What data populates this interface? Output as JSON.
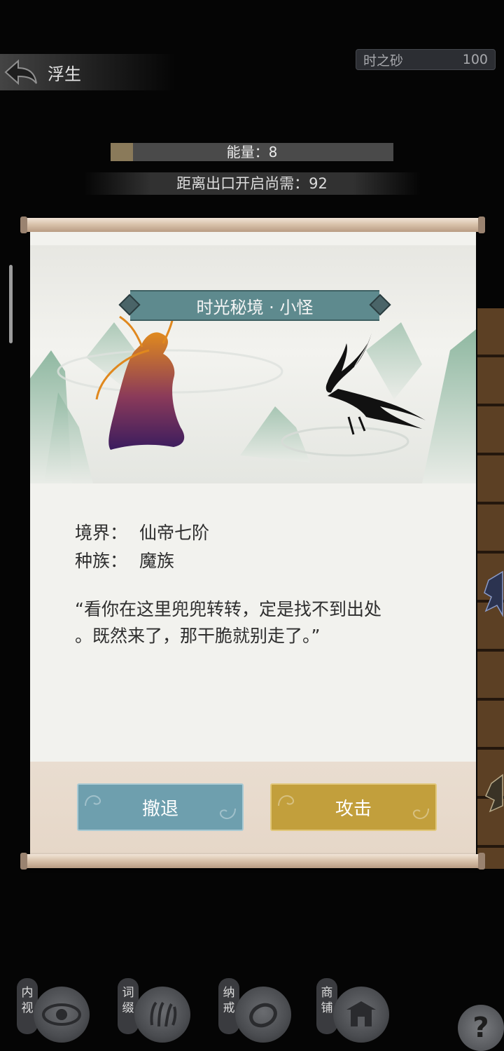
{
  "header": {
    "back_title": "浮生",
    "currency_label": "时之砂",
    "currency_value": "100"
  },
  "status": {
    "energy_text": "能量：8",
    "energy_progress": 0.08,
    "exit_text": "距离出口开启尚需：92"
  },
  "dialog": {
    "title": "时光秘境 · 小怪",
    "realm_label": "境界：",
    "realm_value": "仙帝七阶",
    "race_label": "种族：",
    "race_value": "魔族",
    "quote_line1": "“看你在这里兜兜转转，定是找不到出处",
    "quote_line2": "。既然来了，那干脆就别走了。”",
    "retreat_label": "撤退",
    "attack_label": "攻击"
  },
  "nav": [
    {
      "tag": "内视",
      "icon": "eye-icon"
    },
    {
      "tag": "词缀",
      "icon": "claw-icon"
    },
    {
      "tag": "纳戒",
      "icon": "ring-icon"
    },
    {
      "tag": "商铺",
      "icon": "shop-icon"
    }
  ],
  "help_label": "?",
  "colors": {
    "retreat": "#6e9fae",
    "attack": "#c29f3c",
    "title_plate": "#5e8a8e"
  }
}
